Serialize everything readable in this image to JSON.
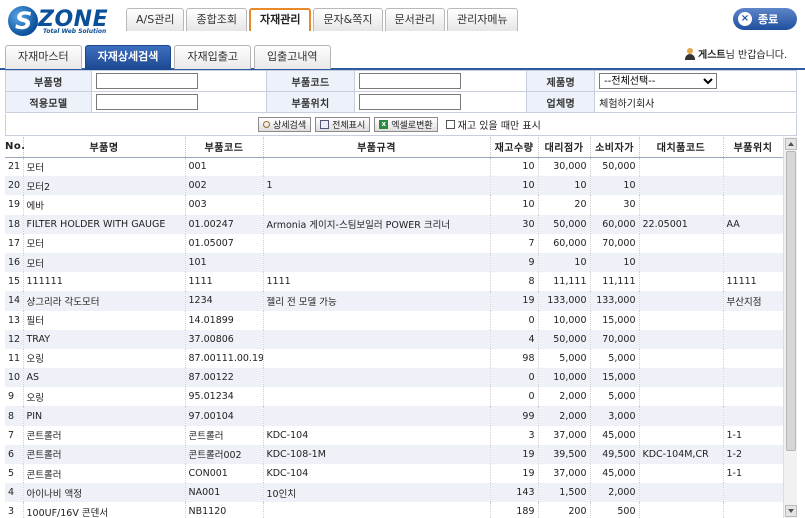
{
  "brand": {
    "name": "ZONE",
    "sub": "Total Web Solution"
  },
  "topnav": [
    "A/S관리",
    "종합조회",
    "자재관리",
    "문자&쪽지",
    "문서관리",
    "관리자메뉴"
  ],
  "topnav_active": 2,
  "exit_label": "종료",
  "subtabs": [
    "자재마스터",
    "자재상세검색",
    "자재입출고",
    "입출고내역"
  ],
  "subtab_active": 1,
  "greeting": {
    "name": "게스트",
    "suffix": "님 반갑습니다."
  },
  "form": {
    "part_name": "부품명",
    "part_code": "부품코드",
    "maker": "제품명",
    "maker_value": "--전체선택--",
    "model": "적용모델",
    "location": "부품위치",
    "company": "업체명",
    "company_value": "체험하기회사"
  },
  "buttons": {
    "detail": "상세검색",
    "all": "전체표시",
    "excel": "엑셀로변환",
    "stock_only": "재고 있을 때만 표시"
  },
  "columns": [
    "No.",
    "부품명",
    "부품코드",
    "부품규격",
    "재고수량",
    "대리점가",
    "소비자가",
    "대치품코드",
    "부품위치"
  ],
  "rows": [
    [
      "21",
      "모터",
      "001",
      "",
      "10",
      "30,000",
      "50,000",
      "",
      ""
    ],
    [
      "20",
      "모터2",
      "002",
      "1",
      "10",
      "10",
      "10",
      "",
      ""
    ],
    [
      "19",
      "에바",
      "003",
      "",
      "10",
      "20",
      "30",
      "",
      ""
    ],
    [
      "18",
      "FILTER HOLDER WITH GAUGE",
      "01.00247",
      "Armonia 게이지-스팀보일러 POWER 크리너",
      "30",
      "50,000",
      "60,000",
      "22.05001",
      "AA"
    ],
    [
      "17",
      "모터",
      "01.05007",
      "",
      "7",
      "60,000",
      "70,000",
      "",
      ""
    ],
    [
      "16",
      "모터",
      "101",
      "",
      "9",
      "10",
      "10",
      "",
      ""
    ],
    [
      "15",
      "111111",
      "1111",
      "1111",
      "8",
      "11,111",
      "11,111",
      "",
      "11111"
    ],
    [
      "14",
      "샹그리라 각도모터",
      "1234",
      "젤리 전 모델 가능",
      "19",
      "133,000",
      "133,000",
      "",
      "부산지점"
    ],
    [
      "13",
      "필터",
      "14.01899",
      "",
      "0",
      "10,000",
      "15,000",
      "",
      ""
    ],
    [
      "12",
      "TRAY",
      "37.00806",
      "",
      "4",
      "50,000",
      "70,000",
      "",
      ""
    ],
    [
      "11",
      "오링",
      "87.00111.00.19",
      "",
      "98",
      "5,000",
      "5,000",
      "",
      ""
    ],
    [
      "10",
      "AS",
      "87.00122",
      "",
      "0",
      "10,000",
      "15,000",
      "",
      ""
    ],
    [
      "9",
      "오링",
      "95.01234",
      "",
      "0",
      "2,000",
      "5,000",
      "",
      ""
    ],
    [
      "8",
      "PIN",
      "97.00104",
      "",
      "99",
      "2,000",
      "3,000",
      "",
      ""
    ],
    [
      "7",
      "콘트롤러",
      "콘트롤러",
      "KDC-104",
      "3",
      "37,000",
      "45,000",
      "",
      "1-1"
    ],
    [
      "6",
      "콘트롤러",
      "콘트롤러002",
      "KDC-108-1M",
      "19",
      "39,500",
      "49,500",
      "KDC-104M,CR",
      "1-2"
    ],
    [
      "5",
      "콘트롤러",
      "CON001",
      "KDC-104",
      "19",
      "37,000",
      "45,000",
      "",
      "1-1"
    ],
    [
      "4",
      "아이나비 액정",
      "NA001",
      "10인치",
      "143",
      "1,500",
      "2,000",
      "",
      ""
    ],
    [
      "3",
      "100UF/16V 콘덴서",
      "NB1120",
      "",
      "189",
      "200",
      "500",
      "",
      ""
    ]
  ]
}
